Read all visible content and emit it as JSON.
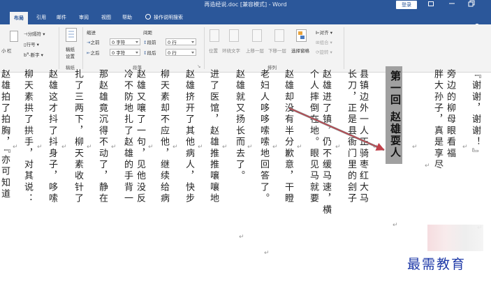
{
  "window": {
    "title": "再造经说.doc [兼容模式] - Word",
    "login_label": "登录",
    "controls": [
      "restore-icon",
      "minimize-icon",
      "maximize-icon"
    ]
  },
  "tabs": [
    {
      "label": "布局",
      "active": true
    },
    {
      "label": "引用"
    },
    {
      "label": "邮件"
    },
    {
      "label": "审阅"
    },
    {
      "label": "视图"
    },
    {
      "label": "帮助"
    },
    {
      "label": "操作说明搜索",
      "icon": "lightbulb-icon"
    }
  ],
  "ribbon": {
    "left_partial": {
      "label1": "小",
      "label2": "栏"
    },
    "page_setup": {
      "breaks": "分隔符",
      "line_numbers": "行号",
      "hyphenation": "断字",
      "group_label": "稿纸",
      "manuscript_line1": "稿纸",
      "manuscript_line2": "设置"
    },
    "indent": {
      "header": "缩进",
      "left_label": "左",
      "left_prefix": "之前",
      "left_value": "0 字符",
      "right_label": "右",
      "right_prefix": "之后",
      "right_value": "0 字符"
    },
    "spacing": {
      "header": "间距",
      "before_label": "段前",
      "before_value": "0 行",
      "after_label": "段后",
      "after_value": "0 行"
    },
    "paragraph_group": "段落",
    "arrange": {
      "position": "位置",
      "wrap": "环绕文字",
      "bring_forward": "上移一层",
      "send_backward": "下移一层",
      "selection_pane": "选择窗格",
      "align": "对齐",
      "group": "组合",
      "rotate": "旋转",
      "group_label": "排列"
    }
  },
  "document": {
    "heading": "第一回 赵雄耍人",
    "columns": [
      "『谢谢，谢谢！』",
      "胖大孙子，真是享尽",
      "旁边的柳母眼看福",
      "第一回 赵雄耍人",
      "县镇边外一人正骑枣红大马",
      "长刀，正是县衙门里的刽子",
      "赵雄进了镇，仍不缓马速，横",
      "个人摔倒在地。眼见马就要",
      "赵雄却没有半分歉意，干瞪",
      "老妇人哆哆嗦嗦地回答了。",
      "赵雄就又扬长而去了。",
      "进了医馆，赵雄推推嚷嚷地",
      "赵雄挤开了其他病人，快步",
      "柳天素却不应他，继续给病",
      "赵雄又嚷了一句，见他没反",
      "冷不防地扎了赵雄的手背一",
      "那赵雄竟沉得不动了，静在",
      "扎了三两下，柳天素收针了",
      "赵雄这才抖了抖身子，哆嗦",
      "柳天素拱了拱手，对其说：",
      "赵雄拍了拍胸，『亦可知道"
    ],
    "mark_glyph": "↵",
    "watermark": "最需教育"
  },
  "colors": {
    "title_bar": "#2b579a",
    "heading_highlight": "#a0a0a0",
    "annotation_arrow": "#c0404a",
    "watermark": "#1f3aa8"
  }
}
